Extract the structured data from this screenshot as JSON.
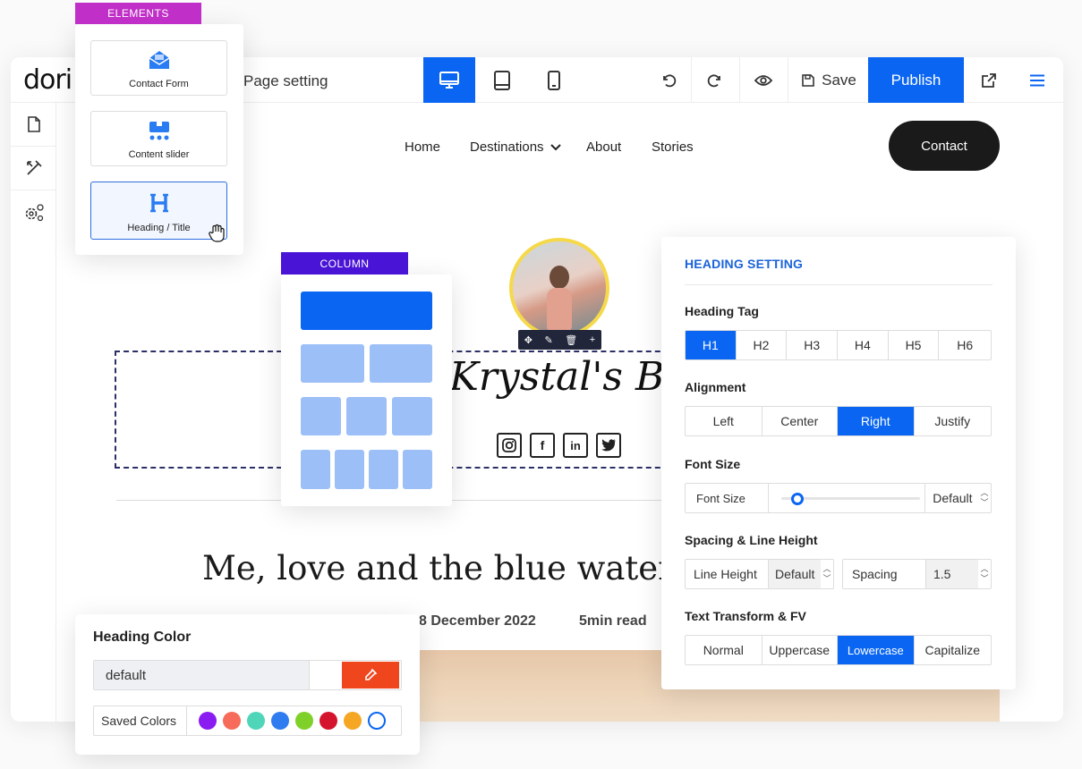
{
  "app": {
    "logo": "dori",
    "page_setting_label": "Page setting",
    "save_label": "Save",
    "publish_label": "Publish"
  },
  "site_nav": {
    "items": [
      "Home",
      "Destinations",
      "About",
      "Stories"
    ],
    "contact_label": "Contact"
  },
  "blog": {
    "title": "Krystal's Blog",
    "heading": "Me, love and the blue water",
    "date": "8 December 2022",
    "read_time": "5min read",
    "social": [
      "instagram-icon",
      "facebook-icon",
      "linkedin-icon",
      "twitter-icon"
    ]
  },
  "elements_panel": {
    "tag": "ELEMENTS",
    "items": [
      {
        "label": "Contact Form",
        "icon": "envelope-icon"
      },
      {
        "label": "Content slider",
        "icon": "slider-icon"
      },
      {
        "label": "Heading / Title",
        "icon": "heading-icon"
      }
    ]
  },
  "column_panel": {
    "tag": "COLUMN"
  },
  "heading_setting": {
    "title": "HEADING SETTING",
    "heading_tag_label": "Heading Tag",
    "tags": [
      "H1",
      "H2",
      "H3",
      "H4",
      "H5",
      "H6"
    ],
    "tag_selected": "H1",
    "alignment_label": "Alignment",
    "alignments": [
      "Left",
      "Center",
      "Right",
      "Justify"
    ],
    "alignment_selected": "Right",
    "font_size_label": "Font Size",
    "font_size_field_label": "Font Size",
    "font_size_value": "Default",
    "font_size_slider_level": 0.12,
    "spacing_label": "Spacing & Line Height",
    "line_height_label": "Line Height",
    "line_height_value": "Default",
    "spacing_field_label": "Spacing",
    "spacing_value": "1.5",
    "transform_label": "Text Transform & FV",
    "transforms": [
      "Normal",
      "Uppercase",
      "Lowercase",
      "Capitalize"
    ],
    "transform_selected": "Lowercase"
  },
  "heading_color": {
    "title": "Heading Color",
    "value": "default",
    "saved_label": "Saved Colors",
    "saved_colors": [
      "#8a1cf2",
      "#f76b5a",
      "#4fd6b8",
      "#2f7cf0",
      "#7fd12a",
      "#d3142c",
      "#f5a623",
      "#ffffff"
    ],
    "picker_color": "#f0461e"
  },
  "colors": {
    "accent": "#0a66f2",
    "elements_tag": "#c02fc7",
    "column_tag": "#4a14d6",
    "column_block": "#9cbff7"
  }
}
